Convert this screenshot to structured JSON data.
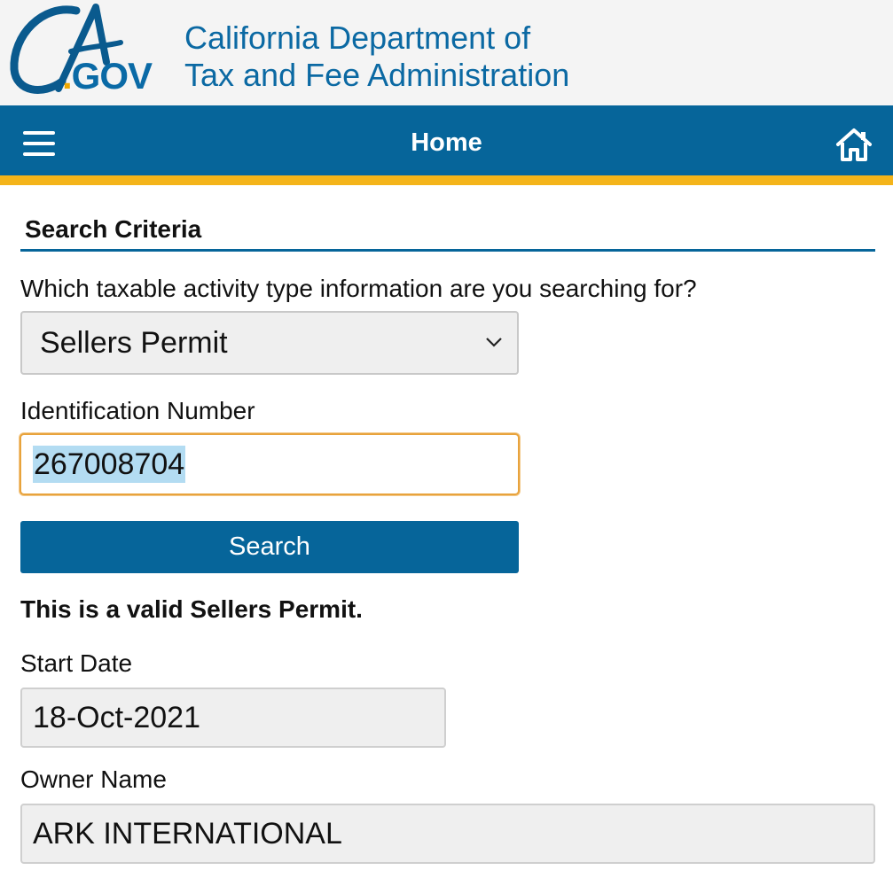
{
  "header": {
    "logo_ca": "CA",
    "logo_dot": ".",
    "logo_gov": "GOV",
    "title_line1": "California Department of",
    "title_line2": "Tax and Fee Administration"
  },
  "navbar": {
    "title": "Home",
    "menu_icon": "hamburger-menu-icon",
    "home_icon": "home-icon"
  },
  "form": {
    "section_title": "Search Criteria",
    "activity_label": "Which taxable activity type information are you searching for?",
    "activity_selected": "Sellers Permit",
    "id_label": "Identification Number",
    "id_value": "267008704",
    "search_button": "Search"
  },
  "result": {
    "message": "This is a valid Sellers Permit.",
    "start_date_label": "Start Date",
    "start_date_value": "18-Oct-2021",
    "owner_name_label": "Owner Name",
    "owner_name_value": "ARK INTERNATIONAL"
  },
  "colors": {
    "brand_blue": "#06659a",
    "accent_gold": "#f4b41a",
    "input_focus": "#e8a33c"
  }
}
